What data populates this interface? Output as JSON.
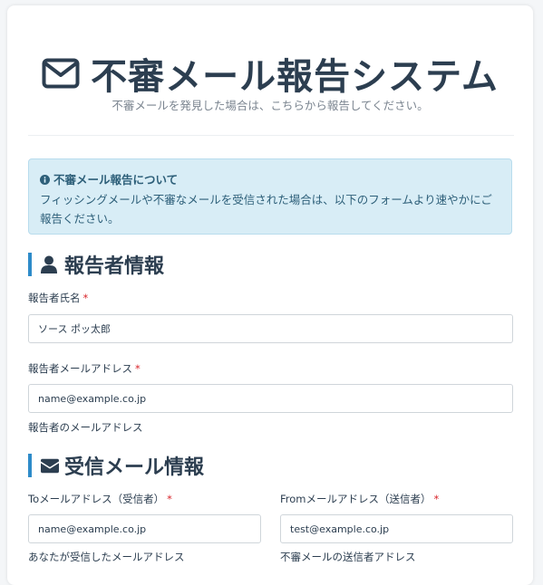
{
  "header": {
    "title": "不審メール報告システム",
    "subtitle": "不審メールを発見した場合は、こちらから報告してください。"
  },
  "notice": {
    "title": "不審メール報告について",
    "body": "フィッシングメールや不審なメールを受信された場合は、以下のフォームより速やかにご報告ください。"
  },
  "reporter_section": {
    "heading": "報告者情報",
    "name_label": "報告者氏名",
    "name_value": "ソース ポッ太郎",
    "email_label": "報告者メールアドレス",
    "email_value": "name@example.co.jp",
    "email_help": "報告者のメールアドレス"
  },
  "received_section": {
    "heading": "受信メール情報",
    "to_label": "Toメールアドレス（受信者）",
    "to_value": "name@example.co.jp",
    "to_help": "あなたが受信したメールアドレス",
    "from_label": "Fromメールアドレス（送信者）",
    "from_value": "test@example.co.jp",
    "from_help": "不審メールの送信者アドレス"
  },
  "required_mark": "*",
  "colors": {
    "accent": "#2e8bc9",
    "text": "#2c3e50",
    "required": "#d9262c",
    "alert_bg": "#d8edf6"
  },
  "icons": {
    "title": "envelope-outline-icon",
    "notice": "info-circle-icon",
    "reporter": "user-icon",
    "received": "envelope-solid-icon"
  }
}
